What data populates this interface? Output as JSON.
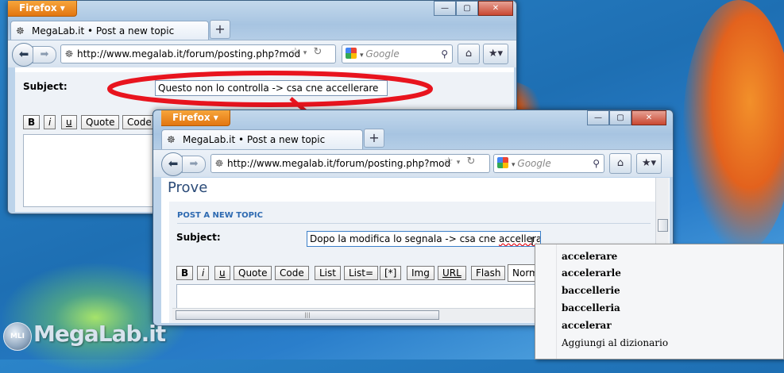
{
  "back_window": {
    "app_button": "Firefox",
    "window_buttons": [
      "—",
      "▢",
      "✕"
    ],
    "tab_title": "MegaLab.it • Post a new topic",
    "new_tab": "+",
    "url": "http://www.megalab.it/forum/posting.php?mod",
    "search_placeholder": "Google",
    "subject_label": "Subject:",
    "subject_value": "Questo non lo controlla -> csa cne accellerare",
    "format_buttons": [
      "B",
      "i",
      "u",
      "Quote",
      "Code"
    ]
  },
  "front_window": {
    "app_button": "Firefox",
    "window_buttons": [
      "—",
      "▢",
      "✕"
    ],
    "tab_title": "MegaLab.it • Post a new topic",
    "new_tab": "+",
    "url": "http://www.megalab.it/forum/posting.php?mod",
    "search_placeholder": "Google",
    "heading": "Prove",
    "section_title": "POST A NEW TOPIC",
    "subject_label": "Subject:",
    "subject_value_before": "Dopo la modifica lo segnala -> csa cne ",
    "subject_value_misspelled": "accellerare",
    "format_buttons": [
      "B",
      "i",
      "u",
      "Quote",
      "Code",
      "List",
      "List=",
      "[*]",
      "Img",
      "URL",
      "Flash"
    ],
    "font_select": "Norm"
  },
  "context_menu": {
    "suggestions": [
      "accelerare",
      "accelerarle",
      "baccellerie",
      "baccelleria",
      "accelerar"
    ],
    "add_to_dictionary": "Aggiungi al dizionario"
  },
  "watermark": "MegaLab.it",
  "colors": {
    "annotation_red": "#e8141e",
    "firefox_orange": "#e27611",
    "section_blue": "#2e6ab1"
  }
}
